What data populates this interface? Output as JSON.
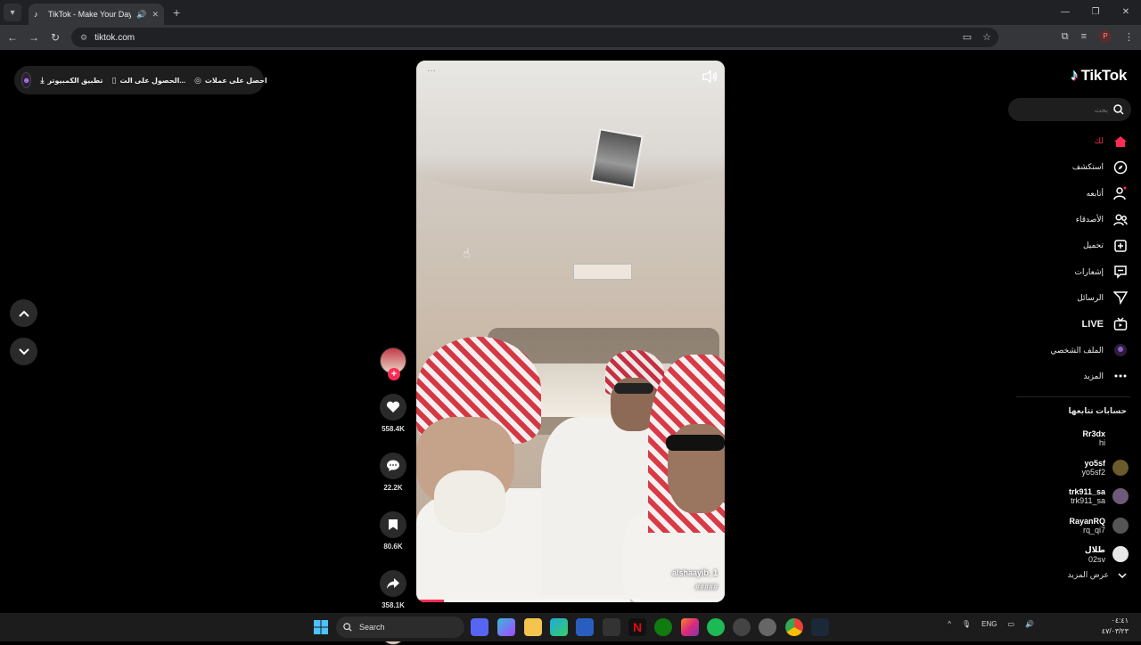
{
  "browser": {
    "tab_title": "TikTok - Make Your Day",
    "url": "tiktok.com",
    "profile_initial": "P"
  },
  "top_bar": {
    "coins_label": "احصل على عملات",
    "get_app_label": "الحصول على الت...",
    "desktop_app_label": "تطبيق الكمبيوتر"
  },
  "video": {
    "author": "alshaayib_1",
    "caption": "#####",
    "progress_percent": 9
  },
  "actions": {
    "likes": "558.4K",
    "comments": "22.2K",
    "saves": "80.6K",
    "shares": "358.1K"
  },
  "sidebar": {
    "brand": "TikTok",
    "search_placeholder": "بحث",
    "menu": [
      {
        "label": "لك",
        "icon": "home-icon"
      },
      {
        "label": "استكشف",
        "icon": "compass-icon"
      },
      {
        "label": "أتابعه",
        "icon": "following-icon"
      },
      {
        "label": "الأصدقاء",
        "icon": "friends-icon"
      },
      {
        "label": "تحميل",
        "icon": "upload-icon"
      },
      {
        "label": "إشعارات",
        "icon": "inbox-icon"
      },
      {
        "label": "الرسائل",
        "icon": "send-icon"
      },
      {
        "label": "LIVE",
        "icon": "live-icon"
      },
      {
        "label": "الملف الشخصي",
        "icon": "profile-icon"
      },
      {
        "label": "المزيد",
        "icon": "more-icon"
      }
    ],
    "following_title": "حسابات تتابعها",
    "following": [
      {
        "name": "Rr3dx",
        "handle": "hi"
      },
      {
        "name": "yo5sf",
        "handle": "yo5sf2"
      },
      {
        "name": "trk911_sa",
        "handle": "trk911_sa"
      },
      {
        "name": "RayanRQ",
        "handle": "rq_qi7"
      },
      {
        "name": "طلال",
        "handle": "02sv"
      }
    ],
    "see_more": "عرض المزيد"
  },
  "taskbar": {
    "search_label": "Search",
    "lang": "ENG",
    "time": "٠٤:٤١",
    "date": "٤٧/٠٣/٢٣"
  },
  "colors": {
    "accent": "#fe2c55",
    "background": "#000000",
    "panel": "#1e1e1e"
  }
}
